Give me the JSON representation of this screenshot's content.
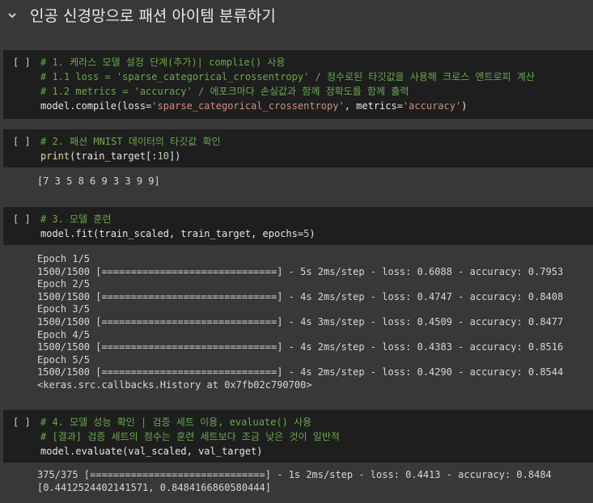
{
  "section": {
    "title": "인공 신경망으로 패션 아이템 분류하기"
  },
  "cells": [
    {
      "run_label": "[ ]",
      "code": [
        {
          "parts": [
            {
              "t": "# 1. 케라스 모델 설정 단계(추가)| complie() 사용",
              "c": "cmt"
            }
          ]
        },
        {
          "parts": [
            {
              "t": "# 1.1 loss = 'sparse_categorical_crossentropy' / 정수로된 타깃값을 사용해 크로스 엔트로피 계산",
              "c": "cmt"
            }
          ]
        },
        {
          "parts": [
            {
              "t": "# 1.2 metrics = 'accuracy' / 에포크마다 손실값과 함께 정확도를 함께 출력",
              "c": "cmt"
            }
          ]
        },
        {
          "parts": [
            {
              "t": "model.compile(loss=",
              "c": "plain"
            },
            {
              "t": "'sparse_categorical_crossentropy'",
              "c": "str"
            },
            {
              "t": ", metrics=",
              "c": "plain"
            },
            {
              "t": "'accuracy'",
              "c": "str"
            },
            {
              "t": ")",
              "c": "plain"
            }
          ]
        }
      ],
      "output": []
    },
    {
      "run_label": "[ ]",
      "code": [
        {
          "parts": [
            {
              "t": "# 2. 패션 MNIST 데이터의 타깃값 확인",
              "c": "cmt"
            }
          ]
        },
        {
          "parts": [
            {
              "t": "print",
              "c": "fn"
            },
            {
              "t": "(train_target[:",
              "c": "plain"
            },
            {
              "t": "10",
              "c": "num"
            },
            {
              "t": "])",
              "c": "plain"
            }
          ]
        }
      ],
      "output": [
        "[7 3 5 8 6 9 3 3 9 9]"
      ]
    },
    {
      "run_label": "[ ]",
      "code": [
        {
          "parts": [
            {
              "t": "# 3. 모델 훈련",
              "c": "cmt"
            }
          ]
        },
        {
          "parts": [
            {
              "t": "model.fit(train_scaled, train_target, epochs=",
              "c": "plain"
            },
            {
              "t": "5",
              "c": "num"
            },
            {
              "t": ")",
              "c": "plain"
            }
          ]
        }
      ],
      "output": [
        "Epoch 1/5",
        "1500/1500 [==============================] - 5s 2ms/step - loss: 0.6088 - accuracy: 0.7953",
        "Epoch 2/5",
        "1500/1500 [==============================] - 4s 2ms/step - loss: 0.4747 - accuracy: 0.8408",
        "Epoch 3/5",
        "1500/1500 [==============================] - 4s 3ms/step - loss: 0.4509 - accuracy: 0.8477",
        "Epoch 4/5",
        "1500/1500 [==============================] - 4s 2ms/step - loss: 0.4383 - accuracy: 0.8516",
        "Epoch 5/5",
        "1500/1500 [==============================] - 4s 2ms/step - loss: 0.4290 - accuracy: 0.8544",
        "<keras.src.callbacks.History at 0x7fb02c790700>"
      ]
    },
    {
      "run_label": "[ ]",
      "code": [
        {
          "parts": [
            {
              "t": "# 4. 모델 성능 확인 | 검증 세트 이용, evaluate() 사용",
              "c": "cmt"
            }
          ]
        },
        {
          "parts": [
            {
              "t": "# [결과] 검증 세트의 점수는 훈련 세트보다 조금 낮은 것이 일반적",
              "c": "cmt"
            }
          ]
        },
        {
          "parts": [
            {
              "t": "model.evaluate(val_scaled, val_target)",
              "c": "plain"
            }
          ]
        }
      ],
      "output": [
        "375/375 [==============================] - 1s 2ms/step - loss: 0.4413 - accuracy: 0.8484",
        "[0.4412524402141571, 0.8484166860580444]"
      ]
    }
  ]
}
